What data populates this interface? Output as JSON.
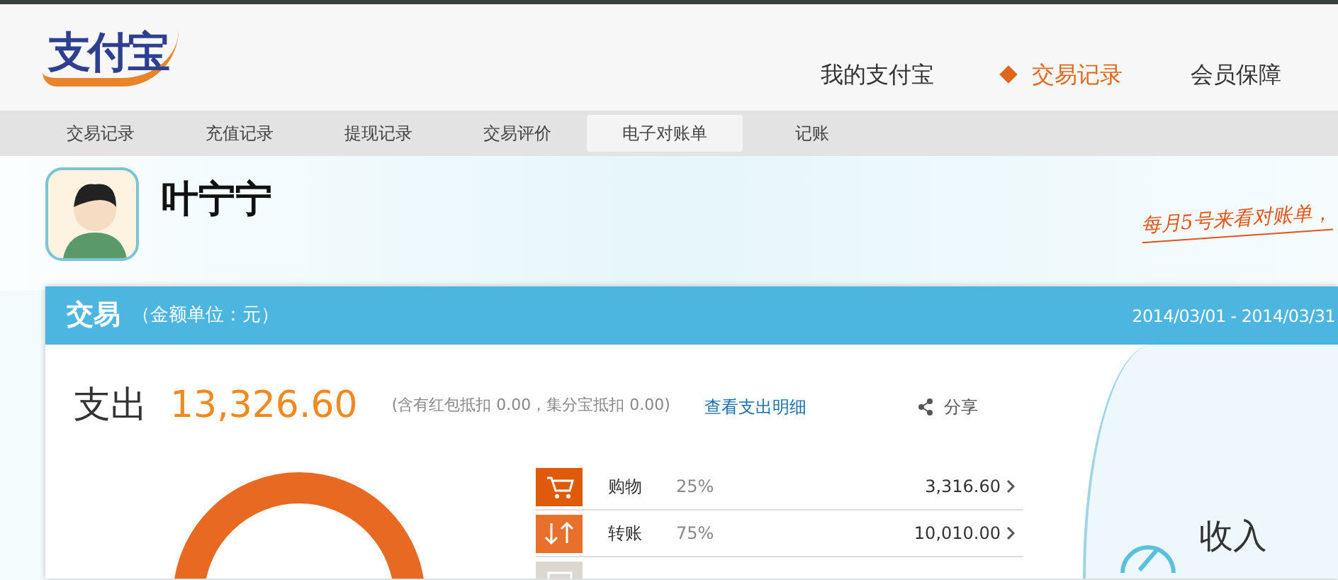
{
  "logo": {
    "text": "支付宝"
  },
  "main_nav": [
    {
      "label": "我的支付宝",
      "selected": false
    },
    {
      "label": "交易记录",
      "selected": true
    },
    {
      "label": "会员保障",
      "selected": false
    }
  ],
  "sub_nav": [
    {
      "label": "交易记录",
      "selected": false
    },
    {
      "label": "充值记录",
      "selected": false
    },
    {
      "label": "提现记录",
      "selected": false
    },
    {
      "label": "交易评价",
      "selected": false
    },
    {
      "label": "电子对账单",
      "selected": true
    },
    {
      "label": "记账",
      "selected": false
    }
  ],
  "user": {
    "name": "叶宁宁"
  },
  "handwritten_note": "每月5号来看对账单，",
  "panel": {
    "title": "交易",
    "unit": "（金额单位：元）",
    "date_range": "2014/03/01 - 2014/03/31"
  },
  "expense": {
    "label": "支出",
    "amount": "13,326.60",
    "note": "(含有红包抵扣 0.00，集分宝抵扣 0.00)",
    "detail_link": "查看支出明细",
    "share": "分享"
  },
  "categories": [
    {
      "kind": "cart",
      "color": "#e05a0c",
      "name": "购物",
      "percent": "25%",
      "amount": "3,316.60"
    },
    {
      "kind": "transfer",
      "color": "#e8702a",
      "name": "转账",
      "percent": "75%",
      "amount": "10,010.00"
    },
    {
      "kind": "card",
      "color": "#dcd8d0"
    }
  ],
  "income": {
    "label": "收入"
  }
}
